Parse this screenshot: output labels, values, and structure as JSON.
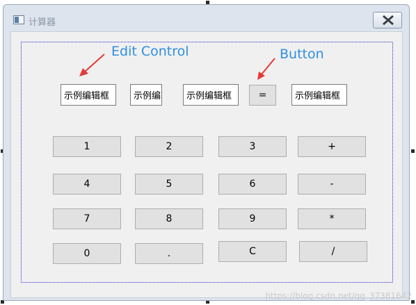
{
  "window": {
    "title": "计算器"
  },
  "edits": {
    "e1": "示例编辑框",
    "e2": "示例编辑框",
    "e3": "示例编辑框",
    "e4": "示例编辑框"
  },
  "equals_label": "=",
  "keypad": {
    "row1": [
      "1",
      "2",
      "3",
      "+"
    ],
    "row2": [
      "4",
      "5",
      "6",
      "-"
    ],
    "row3": [
      "7",
      "8",
      "9",
      "*"
    ],
    "row4": [
      "0",
      ".",
      "C",
      "/"
    ]
  },
  "annotations": {
    "edit": "Edit Control",
    "button": "Button"
  },
  "watermark": "https://blog.csdn.net/qq_37381642",
  "colors": {
    "annotation": "#2f8fde",
    "arrow": "#e53935",
    "group_border": "#2a2ad0"
  }
}
